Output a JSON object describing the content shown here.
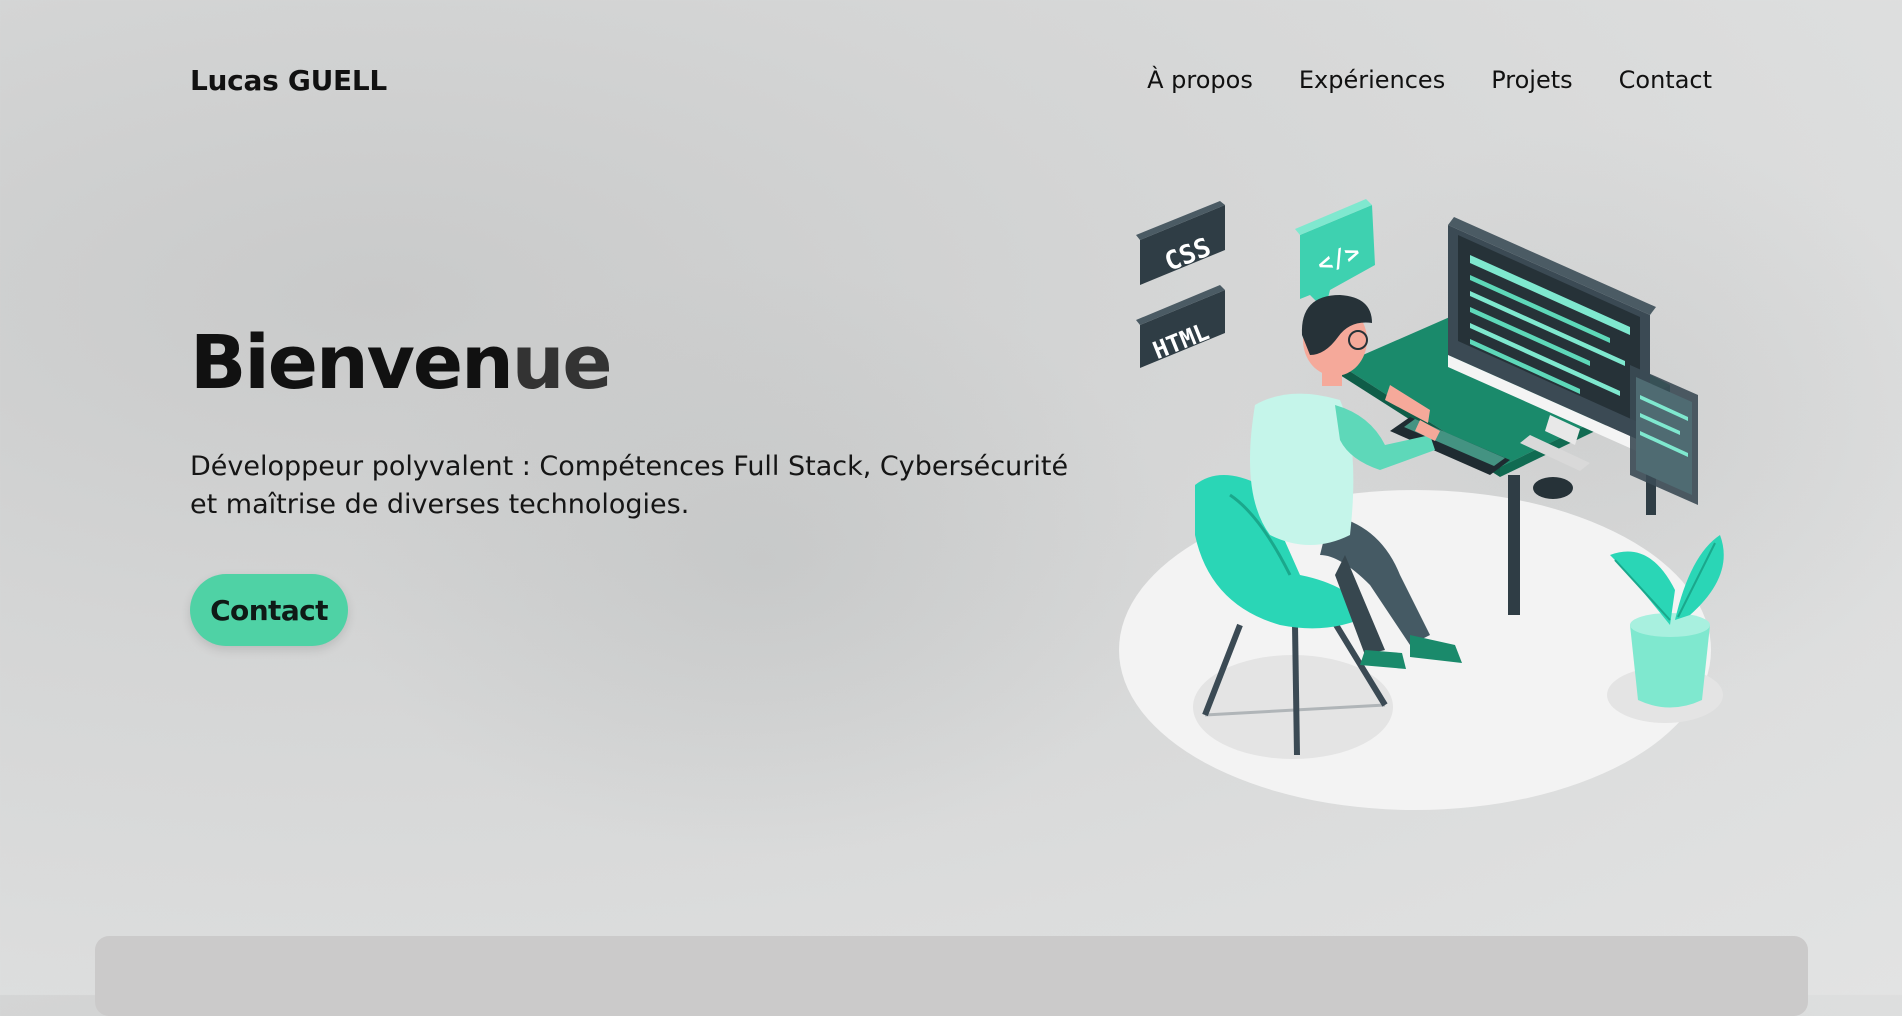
{
  "header": {
    "brand": "Lucas GUELL",
    "nav": [
      "À propos",
      "Expériences",
      "Projets",
      "Contact"
    ]
  },
  "hero": {
    "title_main": "Bienven",
    "title_fade": "ue",
    "tagline": "Développeur polyvalent : Compétences Full Stack, Cybersécurité et maîtrise de diverses technologies.",
    "cta_label": "Contact"
  },
  "illustration": {
    "tag_css": "CSS",
    "tag_html": "HTML",
    "tag_code": "</>"
  },
  "colors": {
    "accent": "#4fd2a5",
    "teal_dark": "#167c63",
    "teal_light": "#7fe8cf",
    "slate": "#3b4a54"
  }
}
